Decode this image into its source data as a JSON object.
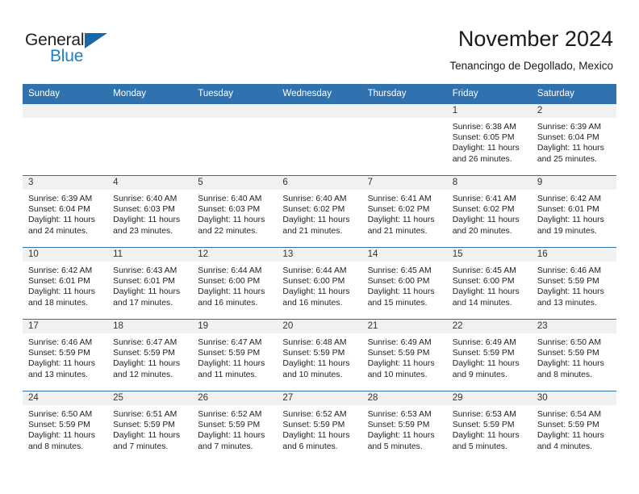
{
  "brand": {
    "name_top": "General",
    "name_bottom": "Blue",
    "accent_color": "#1f7ec4",
    "triangle_color": "#1668a8"
  },
  "header": {
    "title": "November 2024",
    "subtitle": "Tenancingo de Degollado, Mexico",
    "header_bg_color": "#3071b0",
    "daynum_band_color": "#f1f1f1"
  },
  "calendar": {
    "weekday_headers": [
      "Sunday",
      "Monday",
      "Tuesday",
      "Wednesday",
      "Thursday",
      "Friday",
      "Saturday"
    ],
    "weeks": [
      [
        {
          "day": "",
          "empty": true
        },
        {
          "day": "",
          "empty": true
        },
        {
          "day": "",
          "empty": true
        },
        {
          "day": "",
          "empty": true
        },
        {
          "day": "",
          "empty": true
        },
        {
          "day": "1",
          "sunrise": "Sunrise: 6:38 AM",
          "sunset": "Sunset: 6:05 PM",
          "daylight": "Daylight: 11 hours and 26 minutes."
        },
        {
          "day": "2",
          "sunrise": "Sunrise: 6:39 AM",
          "sunset": "Sunset: 6:04 PM",
          "daylight": "Daylight: 11 hours and 25 minutes."
        }
      ],
      [
        {
          "day": "3",
          "sunrise": "Sunrise: 6:39 AM",
          "sunset": "Sunset: 6:04 PM",
          "daylight": "Daylight: 11 hours and 24 minutes."
        },
        {
          "day": "4",
          "sunrise": "Sunrise: 6:40 AM",
          "sunset": "Sunset: 6:03 PM",
          "daylight": "Daylight: 11 hours and 23 minutes."
        },
        {
          "day": "5",
          "sunrise": "Sunrise: 6:40 AM",
          "sunset": "Sunset: 6:03 PM",
          "daylight": "Daylight: 11 hours and 22 minutes."
        },
        {
          "day": "6",
          "sunrise": "Sunrise: 6:40 AM",
          "sunset": "Sunset: 6:02 PM",
          "daylight": "Daylight: 11 hours and 21 minutes."
        },
        {
          "day": "7",
          "sunrise": "Sunrise: 6:41 AM",
          "sunset": "Sunset: 6:02 PM",
          "daylight": "Daylight: 11 hours and 21 minutes."
        },
        {
          "day": "8",
          "sunrise": "Sunrise: 6:41 AM",
          "sunset": "Sunset: 6:02 PM",
          "daylight": "Daylight: 11 hours and 20 minutes."
        },
        {
          "day": "9",
          "sunrise": "Sunrise: 6:42 AM",
          "sunset": "Sunset: 6:01 PM",
          "daylight": "Daylight: 11 hours and 19 minutes."
        }
      ],
      [
        {
          "day": "10",
          "sunrise": "Sunrise: 6:42 AM",
          "sunset": "Sunset: 6:01 PM",
          "daylight": "Daylight: 11 hours and 18 minutes."
        },
        {
          "day": "11",
          "sunrise": "Sunrise: 6:43 AM",
          "sunset": "Sunset: 6:01 PM",
          "daylight": "Daylight: 11 hours and 17 minutes."
        },
        {
          "day": "12",
          "sunrise": "Sunrise: 6:44 AM",
          "sunset": "Sunset: 6:00 PM",
          "daylight": "Daylight: 11 hours and 16 minutes."
        },
        {
          "day": "13",
          "sunrise": "Sunrise: 6:44 AM",
          "sunset": "Sunset: 6:00 PM",
          "daylight": "Daylight: 11 hours and 16 minutes."
        },
        {
          "day": "14",
          "sunrise": "Sunrise: 6:45 AM",
          "sunset": "Sunset: 6:00 PM",
          "daylight": "Daylight: 11 hours and 15 minutes."
        },
        {
          "day": "15",
          "sunrise": "Sunrise: 6:45 AM",
          "sunset": "Sunset: 6:00 PM",
          "daylight": "Daylight: 11 hours and 14 minutes."
        },
        {
          "day": "16",
          "sunrise": "Sunrise: 6:46 AM",
          "sunset": "Sunset: 5:59 PM",
          "daylight": "Daylight: 11 hours and 13 minutes."
        }
      ],
      [
        {
          "day": "17",
          "sunrise": "Sunrise: 6:46 AM",
          "sunset": "Sunset: 5:59 PM",
          "daylight": "Daylight: 11 hours and 13 minutes."
        },
        {
          "day": "18",
          "sunrise": "Sunrise: 6:47 AM",
          "sunset": "Sunset: 5:59 PM",
          "daylight": "Daylight: 11 hours and 12 minutes."
        },
        {
          "day": "19",
          "sunrise": "Sunrise: 6:47 AM",
          "sunset": "Sunset: 5:59 PM",
          "daylight": "Daylight: 11 hours and 11 minutes."
        },
        {
          "day": "20",
          "sunrise": "Sunrise: 6:48 AM",
          "sunset": "Sunset: 5:59 PM",
          "daylight": "Daylight: 11 hours and 10 minutes."
        },
        {
          "day": "21",
          "sunrise": "Sunrise: 6:49 AM",
          "sunset": "Sunset: 5:59 PM",
          "daylight": "Daylight: 11 hours and 10 minutes."
        },
        {
          "day": "22",
          "sunrise": "Sunrise: 6:49 AM",
          "sunset": "Sunset: 5:59 PM",
          "daylight": "Daylight: 11 hours and 9 minutes."
        },
        {
          "day": "23",
          "sunrise": "Sunrise: 6:50 AM",
          "sunset": "Sunset: 5:59 PM",
          "daylight": "Daylight: 11 hours and 8 minutes."
        }
      ],
      [
        {
          "day": "24",
          "sunrise": "Sunrise: 6:50 AM",
          "sunset": "Sunset: 5:59 PM",
          "daylight": "Daylight: 11 hours and 8 minutes."
        },
        {
          "day": "25",
          "sunrise": "Sunrise: 6:51 AM",
          "sunset": "Sunset: 5:59 PM",
          "daylight": "Daylight: 11 hours and 7 minutes."
        },
        {
          "day": "26",
          "sunrise": "Sunrise: 6:52 AM",
          "sunset": "Sunset: 5:59 PM",
          "daylight": "Daylight: 11 hours and 7 minutes."
        },
        {
          "day": "27",
          "sunrise": "Sunrise: 6:52 AM",
          "sunset": "Sunset: 5:59 PM",
          "daylight": "Daylight: 11 hours and 6 minutes."
        },
        {
          "day": "28",
          "sunrise": "Sunrise: 6:53 AM",
          "sunset": "Sunset: 5:59 PM",
          "daylight": "Daylight: 11 hours and 5 minutes."
        },
        {
          "day": "29",
          "sunrise": "Sunrise: 6:53 AM",
          "sunset": "Sunset: 5:59 PM",
          "daylight": "Daylight: 11 hours and 5 minutes."
        },
        {
          "day": "30",
          "sunrise": "Sunrise: 6:54 AM",
          "sunset": "Sunset: 5:59 PM",
          "daylight": "Daylight: 11 hours and 4 minutes."
        }
      ]
    ]
  }
}
